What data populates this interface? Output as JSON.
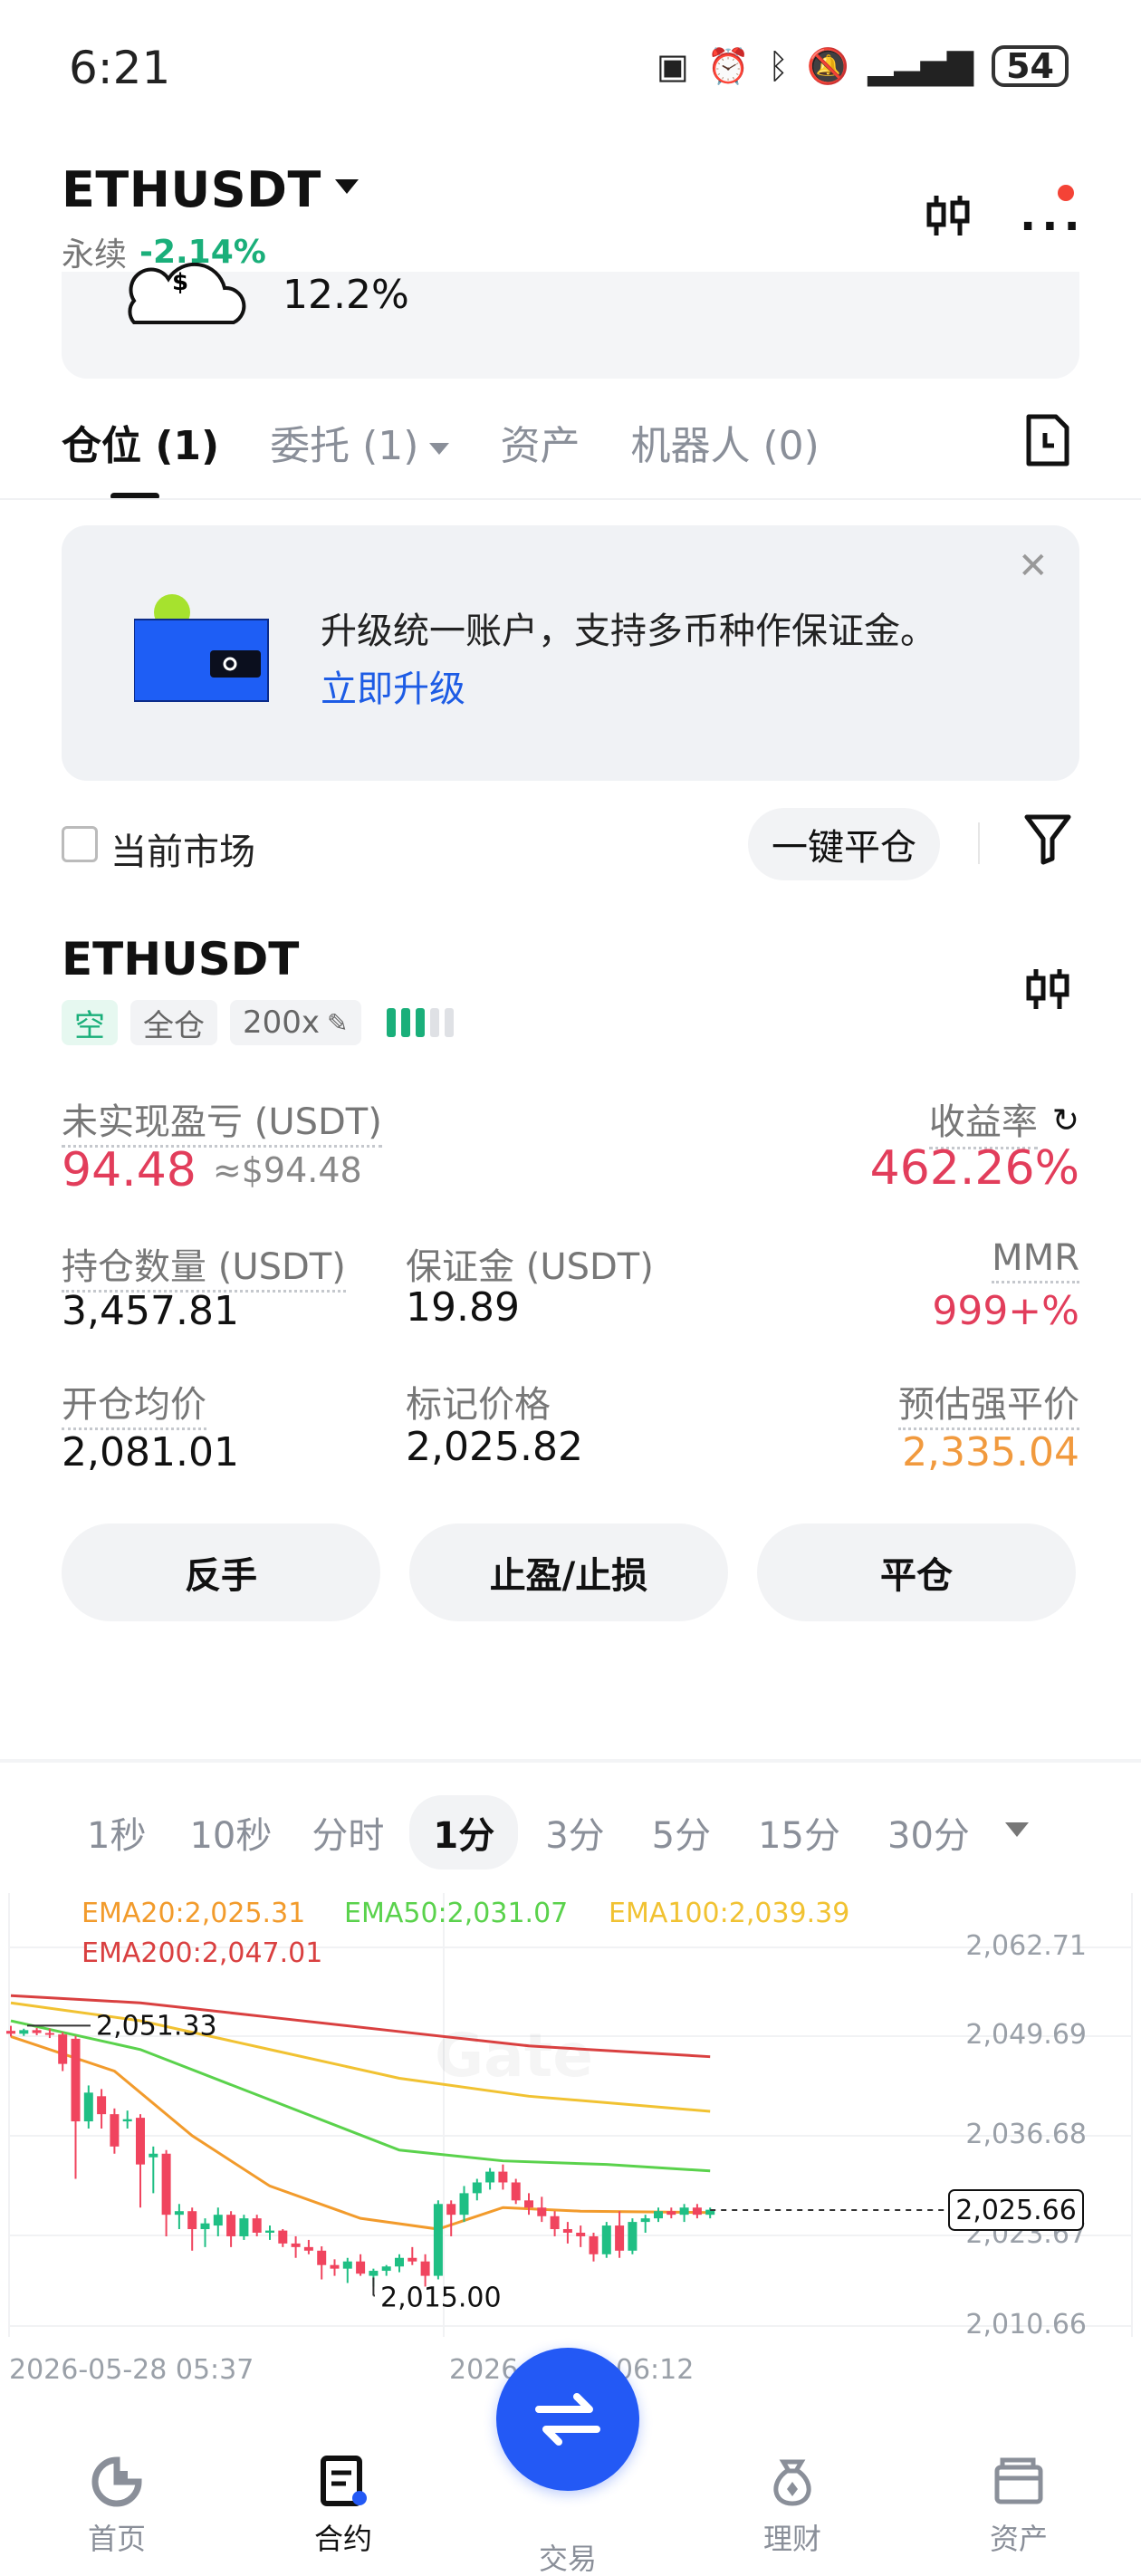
{
  "status_bar": {
    "time": "6:21",
    "battery": "54",
    "icons": [
      "nfc-icon",
      "alarm-icon",
      "bluetooth-icon",
      "battery-saver-icon",
      "mute-icon",
      "signal-icon"
    ]
  },
  "header": {
    "symbol": "ETHUSDT",
    "contract_type": "永续",
    "change": "-2.14%"
  },
  "card_fragment": {
    "rate": "12.2%"
  },
  "tabs": [
    {
      "label": "仓位 (1)",
      "active": true
    },
    {
      "label": "委托 (1)",
      "active": false
    },
    {
      "label": "资产",
      "active": false
    },
    {
      "label": "机器人 (0)",
      "active": false
    }
  ],
  "banner": {
    "text": "升级统一账户，支持多币种作保证金。",
    "link": "立即升级"
  },
  "filter": {
    "current_market": "当前市场",
    "close_all": "一键平仓"
  },
  "position": {
    "symbol": "ETHUSDT",
    "side_tag": "空",
    "margin_mode": "全仓",
    "leverage": "200x",
    "risk_level": 3,
    "unrealized_pnl_label": "未实现盈亏 (USDT)",
    "unrealized_pnl": "94.48",
    "unrealized_pnl_usd": "≈$94.48",
    "roe_label": "收益率",
    "roe": "462.26%",
    "size_label": "持仓数量 (USDT)",
    "size": "3,457.81",
    "margin_label": "保证金 (USDT)",
    "margin": "19.89",
    "mmr_label": "MMR",
    "mmr": "999+%",
    "entry_label": "开仓均价",
    "entry": "2,081.01",
    "mark_label": "标记价格",
    "mark": "2,025.82",
    "liq_label": "预估强平价",
    "liq": "2,335.04",
    "actions": [
      "反手",
      "止盈/止损",
      "平仓"
    ]
  },
  "chart": {
    "intervals": [
      "1秒",
      "10秒",
      "分时",
      "1分",
      "3分",
      "5分",
      "15分",
      "30分"
    ],
    "active_interval": "1分",
    "ema_labels": {
      "ema20": "EMA20:2,025.31",
      "ema50": "EMA50:2,031.07",
      "ema100": "EMA100:2,039.39",
      "ema200": "EMA200:2,047.01"
    },
    "y_ticks": [
      "2,062.71",
      "2,049.69",
      "2,036.68",
      "2,023.67",
      "2,010.66"
    ],
    "last_price": "2,025.66",
    "high_label": "2,051.33",
    "low_label": "2,015.00",
    "x_ticks": [
      "2026-05-28 05:37",
      "2026-05-28 06:12"
    ],
    "colors": {
      "up": "#1fbf84",
      "down": "#f0445e",
      "ema20": "#f29b2c",
      "ema50": "#5ad24c",
      "ema100": "#f1c232",
      "ema200": "#d94040"
    }
  },
  "chart_data": {
    "type": "candlestick",
    "ylim": [
      2008,
      2066
    ],
    "x_ticks": [
      "2026-05-28 05:37",
      "2026-05-28 06:12"
    ],
    "candles": [
      [
        2050.6,
        2051.3,
        2049.8,
        2050.2
      ],
      [
        2050.2,
        2050.9,
        2049.9,
        2050.7
      ],
      [
        2050.7,
        2051.0,
        2050.0,
        2050.3
      ],
      [
        2050.3,
        2050.9,
        2049.6,
        2050.1
      ],
      [
        2050.1,
        2050.4,
        2045.0,
        2046.0
      ],
      [
        2049.5,
        2049.9,
        2030.0,
        2038.0
      ],
      [
        2038.0,
        2043.0,
        2037.0,
        2042.0
      ],
      [
        2041.5,
        2042.5,
        2037.0,
        2039.0
      ],
      [
        2039.0,
        2039.8,
        2033.5,
        2034.5
      ],
      [
        2038.0,
        2039.5,
        2037.0,
        2038.3
      ],
      [
        2038.5,
        2039.0,
        2026.0,
        2032.0
      ],
      [
        2033.0,
        2034.5,
        2028.0,
        2033.5
      ],
      [
        2033.5,
        2034.0,
        2022.0,
        2025.0
      ],
      [
        2025.0,
        2026.5,
        2023.0,
        2025.5
      ],
      [
        2025.5,
        2026.0,
        2020.0,
        2023.0
      ],
      [
        2023.0,
        2024.5,
        2020.5,
        2023.8
      ],
      [
        2023.5,
        2026.0,
        2022.0,
        2025.0
      ],
      [
        2025.0,
        2025.5,
        2020.5,
        2022.0
      ],
      [
        2022.0,
        2025.0,
        2021.5,
        2024.5
      ],
      [
        2024.5,
        2025.0,
        2022.0,
        2022.5
      ],
      [
        2022.5,
        2023.5,
        2021.5,
        2022.8
      ],
      [
        2022.8,
        2023.0,
        2020.5,
        2021.0
      ],
      [
        2021.0,
        2022.0,
        2019.0,
        2020.5
      ],
      [
        2020.5,
        2021.5,
        2019.5,
        2020.0
      ],
      [
        2020.0,
        2020.6,
        2016.0,
        2018.0
      ],
      [
        2018.0,
        2018.8,
        2016.5,
        2017.5
      ],
      [
        2017.5,
        2019.0,
        2015.5,
        2018.5
      ],
      [
        2018.5,
        2019.5,
        2016.5,
        2016.8
      ],
      [
        2016.5,
        2017.5,
        2015.0,
        2017.2
      ],
      [
        2017.2,
        2018.0,
        2016.5,
        2017.8
      ],
      [
        2017.8,
        2019.5,
        2017.0,
        2019.0
      ],
      [
        2019.0,
        2020.5,
        2018.0,
        2018.5
      ],
      [
        2018.5,
        2019.5,
        2015.0,
        2016.5
      ],
      [
        2016.5,
        2027.0,
        2016.0,
        2026.5
      ],
      [
        2026.5,
        2027.0,
        2022.0,
        2025.0
      ],
      [
        2025.0,
        2029.0,
        2024.0,
        2028.0
      ],
      [
        2028.0,
        2030.0,
        2027.0,
        2029.5
      ],
      [
        2029.5,
        2031.5,
        2028.5,
        2031.0
      ],
      [
        2031.0,
        2032.0,
        2028.5,
        2029.5
      ],
      [
        2029.5,
        2030.0,
        2026.5,
        2027.0
      ],
      [
        2027.0,
        2028.0,
        2025.0,
        2026.0
      ],
      [
        2026.0,
        2027.5,
        2024.0,
        2024.8
      ],
      [
        2024.8,
        2025.5,
        2022.0,
        2023.0
      ],
      [
        2023.0,
        2024.0,
        2021.0,
        2022.5
      ],
      [
        2022.5,
        2023.5,
        2020.5,
        2022.0
      ],
      [
        2022.0,
        2022.5,
        2018.5,
        2019.5
      ],
      [
        2019.5,
        2024.0,
        2019.0,
        2023.5
      ],
      [
        2023.5,
        2025.5,
        2019.0,
        2020.0
      ],
      [
        2020.0,
        2024.5,
        2019.5,
        2024.0
      ],
      [
        2024.0,
        2025.0,
        2022.5,
        2024.5
      ],
      [
        2024.5,
        2026.0,
        2024.0,
        2025.5
      ],
      [
        2025.5,
        2026.0,
        2024.5,
        2025.0
      ],
      [
        2025.0,
        2026.5,
        2024.0,
        2026.0
      ],
      [
        2026.0,
        2026.5,
        2024.5,
        2025.0
      ],
      [
        2025.0,
        2026.0,
        2024.5,
        2025.7
      ]
    ],
    "ema20": [
      [
        0,
        2049.8
      ],
      [
        8,
        2045
      ],
      [
        14,
        2036
      ],
      [
        20,
        2029
      ],
      [
        27,
        2024.5
      ],
      [
        33,
        2023
      ],
      [
        38,
        2026
      ],
      [
        44,
        2025.5
      ],
      [
        54,
        2025.3
      ]
    ],
    "ema50": [
      [
        0,
        2052
      ],
      [
        10,
        2048
      ],
      [
        20,
        2041
      ],
      [
        30,
        2034
      ],
      [
        38,
        2032.5
      ],
      [
        46,
        2032
      ],
      [
        54,
        2031.1
      ]
    ],
    "ema100": [
      [
        0,
        2054.5
      ],
      [
        10,
        2052
      ],
      [
        20,
        2048
      ],
      [
        30,
        2044
      ],
      [
        40,
        2041.5
      ],
      [
        54,
        2039.4
      ]
    ],
    "ema200": [
      [
        0,
        2055.5
      ],
      [
        10,
        2054.5
      ],
      [
        20,
        2052.5
      ],
      [
        30,
        2050.5
      ],
      [
        40,
        2048.5
      ],
      [
        54,
        2047.0
      ]
    ],
    "last_price": 2025.66,
    "high_marker": 2051.33,
    "low_marker": 2015.0
  },
  "bottom_nav": [
    {
      "label": "首页",
      "icon": "home-icon",
      "active": false
    },
    {
      "label": "合约",
      "icon": "futures-icon",
      "active": true
    },
    {
      "label": "交易",
      "icon": "swap-icon",
      "active": false
    },
    {
      "label": "理财",
      "icon": "finance-icon",
      "active": false
    },
    {
      "label": "资产",
      "icon": "wallet-icon",
      "active": false
    }
  ]
}
